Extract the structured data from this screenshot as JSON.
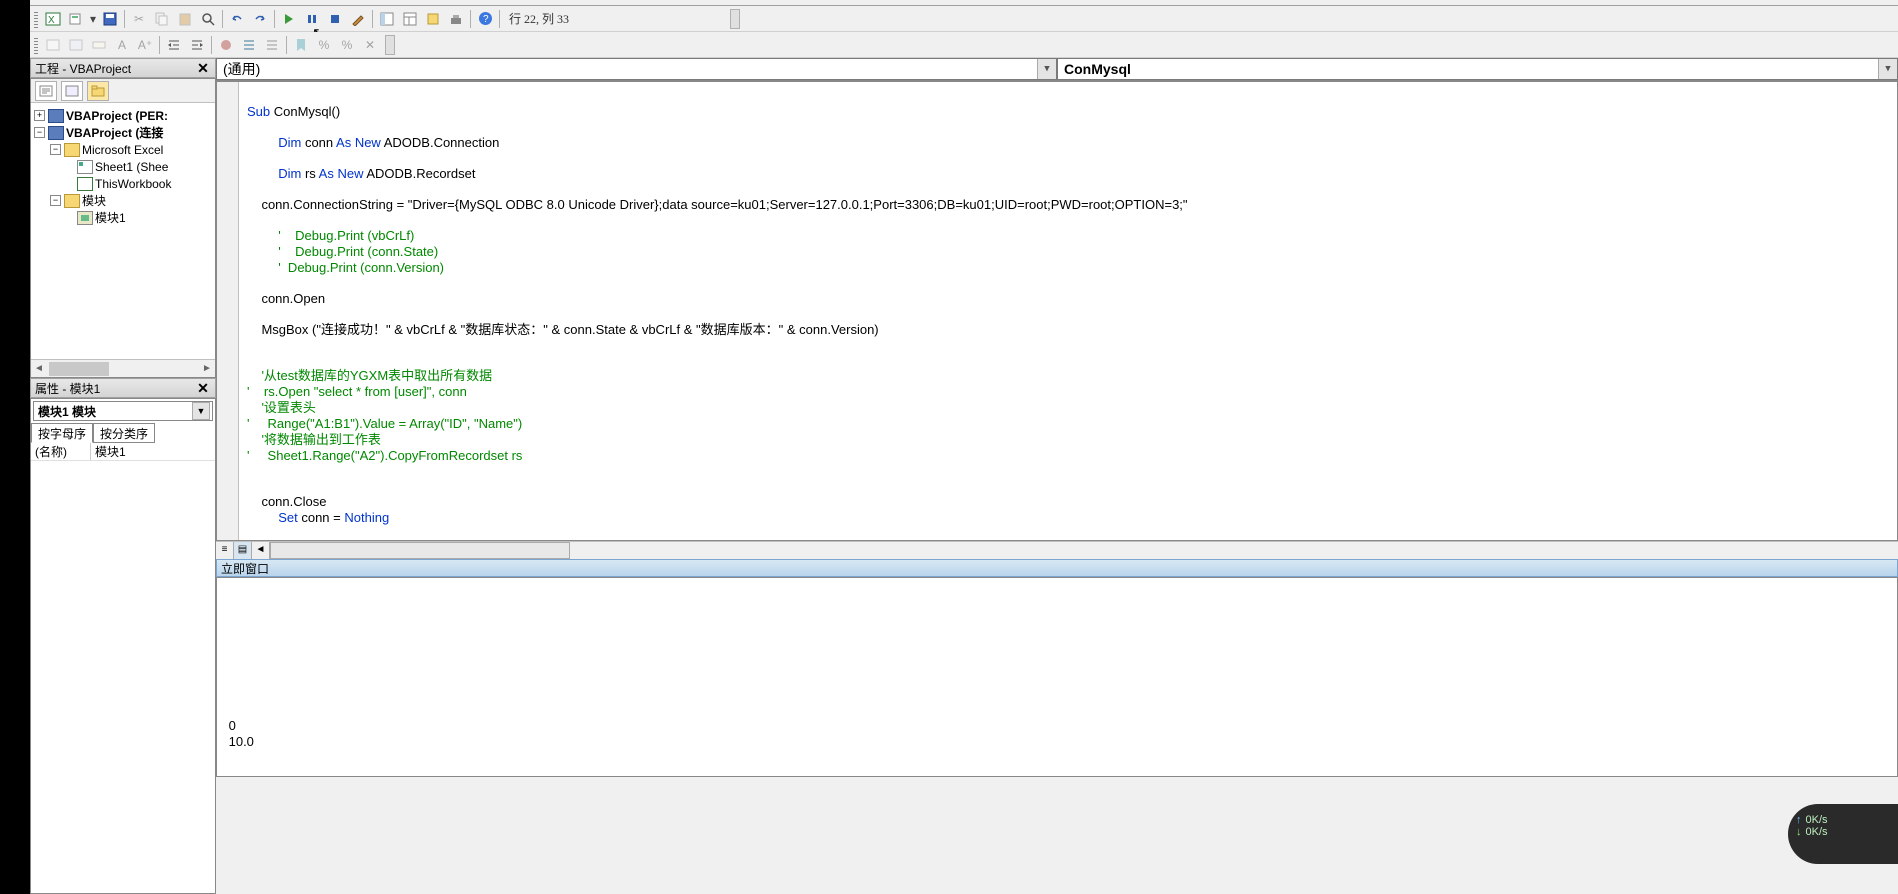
{
  "status": {
    "pos": "行 22, 列 33"
  },
  "project_panel": {
    "title": "工程 - VBAProject",
    "items": [
      {
        "label": "VBAProject (PER:"
      },
      {
        "label": "VBAProject (连接"
      }
    ],
    "excel_obj": "Microsoft Excel",
    "sheet1": "Sheet1 (Shee",
    "thiswb": "ThisWorkbook",
    "modules_folder": "模块",
    "module1": "模块1"
  },
  "props_panel": {
    "title": "属性 - 模块1",
    "combo": "模块1 模块",
    "tab_alpha": "按字母序",
    "tab_cat": "按分类序",
    "row_name_label": "(名称)",
    "row_name_value": "模块1"
  },
  "combo_left": "(通用)",
  "combo_right": "ConMysql",
  "code": {
    "l1a": "Sub",
    "l1b": " ConMysql()",
    "l2a": "Dim",
    "l2b": " conn ",
    "l2c": "As New",
    "l2d": " ADODB.Connection",
    "l3a": "Dim",
    "l3b": " rs ",
    "l3c": "As New",
    "l3d": " ADODB.Recordset",
    "l4": "    conn.ConnectionString = \"Driver={MySQL ODBC 8.0 Unicode Driver};data source=ku01;Server=127.0.0.1;Port=3306;DB=ku01;UID=root;PWD=root;OPTION=3;\"",
    "l5": "'    Debug.Print (vbCrLf)",
    "l6": "'    Debug.Print (conn.State)",
    "l7": "'  Debug.Print (conn.Version)",
    "l8": "    conn.Open",
    "l9": "    MsgBox (\"连接成功！\" & vbCrLf & \"数据库状态：\" & conn.State & vbCrLf & \"数据库版本：\" & conn.Version)",
    "l10": "    '从test数据库的YGXM表中取出所有数据",
    "l11": "'    rs.Open \"select * from [user]\", conn",
    "l12": "    '设置表头",
    "l13": "'     Range(\"A1:B1\").Value = Array(\"ID\", \"Name\")",
    "l14": "    '将数据输出到工作表",
    "l15": "'     Sheet1.Range(\"A2\").CopyFromRecordset rs",
    "l16": "    conn.Close",
    "l17a": "Set",
    "l17b": " conn = ",
    "l17c": "Nothing"
  },
  "immediate": {
    "title": "立即窗口",
    "line1": " 0 ",
    "line2": " 10.0 "
  },
  "net": {
    "up": "0K/s",
    "down": "0K/s"
  }
}
